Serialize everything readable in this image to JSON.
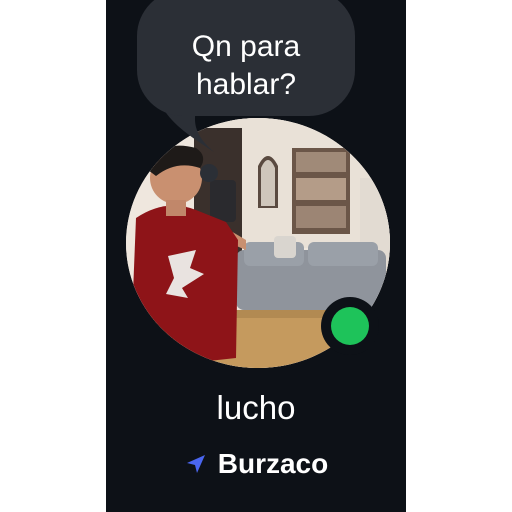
{
  "bubble": {
    "line1": "Qn para",
    "line2": "hablar?"
  },
  "profile": {
    "name": "lucho",
    "location": "Burzaco",
    "online": true
  },
  "icons": {
    "location": "navigation-arrow-icon",
    "status": "online-status-icon"
  },
  "colors": {
    "card_background": "#0d1117",
    "bubble_background": "#2b2f36",
    "online_green": "#1ec35a",
    "location_arrow": "#4a66f0",
    "text": "#ffffff"
  }
}
